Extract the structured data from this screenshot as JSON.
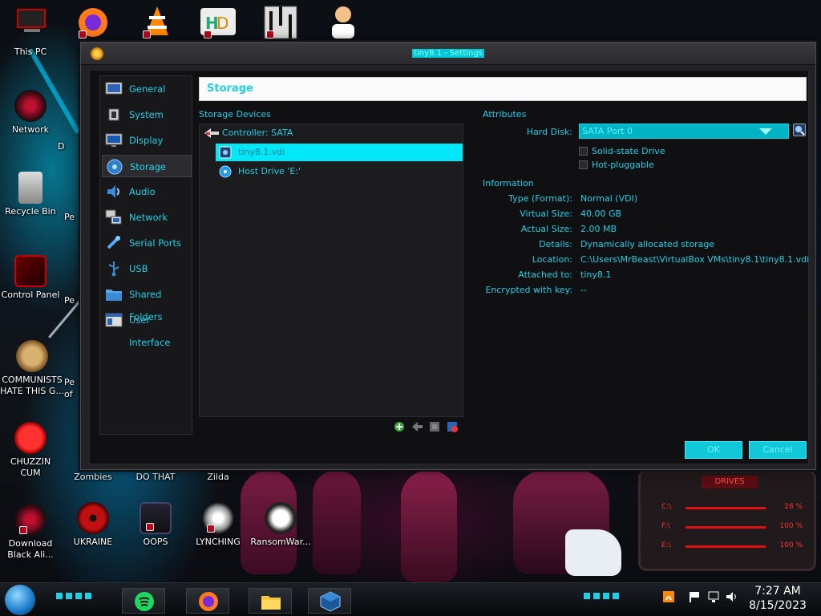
{
  "desktop": {
    "icons": [
      {
        "label": "This PC",
        "icon": "this-pc-icon"
      },
      {
        "label": "Network",
        "icon": "network-icon"
      },
      {
        "label": "Recycle Bin",
        "icon": "recycle-bin-icon"
      },
      {
        "label": "Control Panel",
        "icon": "control-panel-icon"
      },
      {
        "label": "COMMUNISTS HATE THIS G...",
        "icon": "money-bag-icon"
      },
      {
        "label": "CHUZZIN CUM",
        "icon": "chuzzle-icon"
      },
      {
        "label": "Download Black Ali...",
        "icon": "red-orb-icon"
      },
      {
        "label": "UKRAINE",
        "icon": "radiation-icon"
      },
      {
        "label": "OOPS",
        "icon": "oops-icon"
      },
      {
        "label": "LYNCHING",
        "icon": "lynching-icon"
      },
      {
        "label": "RansomWar...",
        "icon": "skull-icon"
      },
      {
        "label": "Zombies",
        "icon": "zombies-icon"
      },
      {
        "label": "DO THAT",
        "icon": "do-that-icon"
      },
      {
        "label": "Zilda",
        "icon": "zilda-icon"
      }
    ],
    "partial_labels": [
      "D",
      "Pe",
      "Pe",
      "Pe",
      "of"
    ]
  },
  "window": {
    "title": "tiny8.1 - Settings",
    "header": "Storage",
    "sidebar": [
      {
        "label": "General",
        "icon": "general-icon"
      },
      {
        "label": "System",
        "icon": "system-chip-icon"
      },
      {
        "label": "Display",
        "icon": "display-monitor-icon"
      },
      {
        "label": "Storage",
        "icon": "storage-disk-icon",
        "active": true
      },
      {
        "label": "Audio",
        "icon": "audio-speaker-icon"
      },
      {
        "label": "Network",
        "icon": "network-adapter-icon"
      },
      {
        "label": "Serial Ports",
        "icon": "serial-port-icon"
      },
      {
        "label": "USB",
        "icon": "usb-icon"
      },
      {
        "label": "Shared Folders",
        "icon": "folder-icon"
      },
      {
        "label": "User Interface",
        "icon": "user-interface-icon"
      }
    ],
    "storage_devices_label": "Storage Devices",
    "tree": {
      "controller": "Controller: SATA",
      "items": [
        {
          "label": "tiny8.1.vdi",
          "icon": "hard-disk-icon",
          "selected": true
        },
        {
          "label": "Host Drive 'E:'",
          "icon": "optical-disc-icon"
        }
      ]
    },
    "attributes_label": "Attributes",
    "hard_disk_label": "Hard Disk:",
    "hard_disk_value": "SATA Port 0",
    "solid_state_label": "Solid-state Drive",
    "hot_pluggable_label": "Hot-pluggable",
    "information_label": "Information",
    "info": [
      {
        "label": "Type (Format):",
        "value": "Normal (VDI)"
      },
      {
        "label": "Virtual Size:",
        "value": "40.00 GB"
      },
      {
        "label": "Actual Size:",
        "value": "2.00 MB"
      },
      {
        "label": "Details:",
        "value": "Dynamically allocated storage"
      },
      {
        "label": "Location:",
        "value": "C:\\Users\\MrBeast\\VirtualBox VMs\\tiny8.1\\tiny8.1.vdi"
      },
      {
        "label": "Attached to:",
        "value": "tiny8.1"
      },
      {
        "label": "Encrypted with key:",
        "value": "--"
      }
    ],
    "ok_label": "OK",
    "cancel_label": "Cancel"
  },
  "drives_widget": {
    "title": "DRIVES",
    "rows": [
      {
        "drive": "C:\\",
        "value": "28 %"
      },
      {
        "drive": "F:\\",
        "value": "100 %"
      },
      {
        "drive": "E:\\",
        "value": "100 %"
      }
    ]
  },
  "taskbar": {
    "time": "7:27 AM",
    "date": "8/15/2023",
    "apps": [
      "spotify-icon",
      "firefox-icon",
      "file-explorer-icon",
      "virtualbox-icon"
    ]
  },
  "colors": {
    "accent": "#1ecfe6",
    "selection": "#00e8f8",
    "button": "#10c8d8"
  }
}
